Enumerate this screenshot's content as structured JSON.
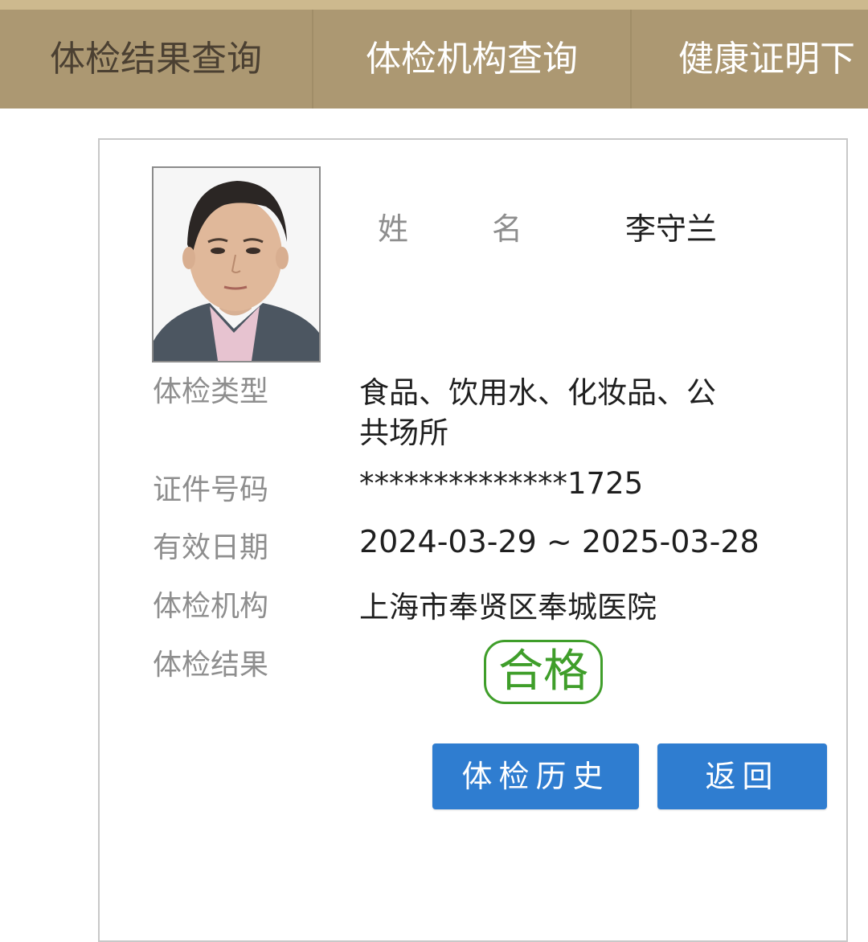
{
  "tabs": [
    {
      "label": "体检结果查询"
    },
    {
      "label": "体检机构查询"
    },
    {
      "label": "健康证明下"
    }
  ],
  "card": {
    "name_label_1": "姓",
    "name_label_2": "名",
    "name_value": "李守兰",
    "fields": {
      "type": {
        "label": "体检类型",
        "value_line1": "食品、饮用水、化妆品、公",
        "value_line2": "共场所"
      },
      "id_number": {
        "label": "证件号码",
        "value": "**************1725"
      },
      "validity": {
        "label": "有效日期",
        "value": "2024-03-29 ~ 2025-03-28"
      },
      "institution": {
        "label": "体检机构",
        "value": "上海市奉贤区奉城医院"
      },
      "result": {
        "label": "体检结果",
        "value": "合格"
      }
    }
  },
  "buttons": {
    "history": "体检历史",
    "back": "返回"
  },
  "colors": {
    "topbar": "#ac9872",
    "button": "#2f7dd0",
    "pass_green": "#3f9e2a"
  }
}
